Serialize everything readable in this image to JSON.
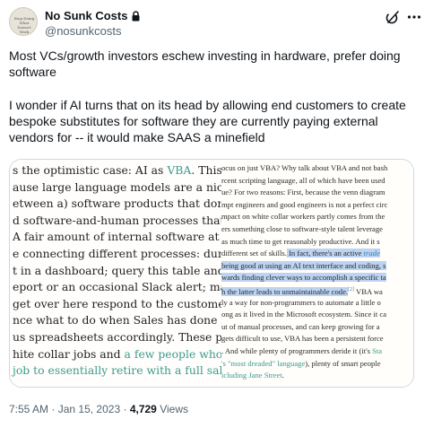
{
  "author": {
    "display_name": "No Sunk Costs",
    "handle": "@nosunkcosts",
    "avatar_text": "Stop Doing What Doesn't Work"
  },
  "tweet": {
    "paragraph_1": "Most VCs/growth investors eschew investing in hardware, prefer doing software",
    "paragraph_2": "I wonder if AI turns that on its head by allowing end customers to create bespoke substitutes for software they are currently paying external vendors for -- it would make SAAS a minefield"
  },
  "media": {
    "left_lines": [
      {
        "pre": "s the optimistic case: AI as ",
        "teal": "VBA",
        "post": ". This c"
      },
      {
        "pre": "ause large language models are a nice",
        "teal": "",
        "post": ""
      },
      {
        "pre": "etween a) software products that don't",
        "teal": "",
        "post": ""
      },
      {
        "pre": "d software-and-human processes that",
        "teal": "",
        "post": ""
      },
      {
        "pre": "A fair amount of internal software at s",
        "teal": "",
        "post": ""
      },
      {
        "pre": "e connecting different processes: dump",
        "teal": "",
        "post": ""
      },
      {
        "pre": "t in a dashboard; query this table and",
        "teal": "",
        "post": ""
      },
      {
        "pre": "eport or an occasional Slack alert; mak",
        "teal": "",
        "post": ""
      },
      {
        "pre": "get over here respond to the customer",
        "teal": "",
        "post": ""
      },
      {
        "pre": "nce what to do when Sales has done its",
        "teal": "",
        "post": ""
      },
      {
        "pre": "us spreadsheets accordingly. These pr",
        "teal": "",
        "post": ""
      },
      {
        "pre": "hite collar jobs and ",
        "teal": "a few people who l",
        "post": ""
      },
      {
        "pre": "",
        "teal": " job to essentially retire with a full sal",
        "post": ""
      }
    ],
    "right_lines": [
      "ocus on just VBA? Why talk about VBA and not bash",
      "rcent scripting language, all of which have been used",
      "ue? For two reasons: First, because the venn diagram",
      "mpt engineers and good engineers is not a perfect circ",
      "mpact on white collar workers partly comes from the",
      "ers something close to software-style talent leverage",
      "as much time to get reasonably productive. And it s",
      "different set of skills.",
      "being good at using an AI text interface and coding, s",
      "wards finding clever ways to accomplish a specific ta",
      "h the latter leads to unmaintainable code.",
      "ly a way for non-programmers to automate a little o",
      "ong as it lived in the Microsoft ecosystem. Since it ca",
      "ut of manual processes, and can keep growing for a",
      "gets difficult to use, VBA has been a persistent force",
      ". And while plenty of programmers deride it (it's Sta",
      "'s \"most dreaded\" language), plenty of smart people",
      "icluding Jane Street."
    ],
    "right_highlight_1": " In fact, there's an active ",
    "right_highlight_1_italic": "trade",
    "right_footnote": "[2]",
    "right_tail_1": " VBA wa",
    "right_teal_1": "Sta",
    "right_teal_2": "'s \"most dreaded\" language",
    "right_teal_3": "icluding Jane Street"
  },
  "footer": {
    "time": "7:55 AM",
    "separator": "·",
    "date": "Jan 15, 2023",
    "views_count": "4,729",
    "views_label": "Views"
  }
}
